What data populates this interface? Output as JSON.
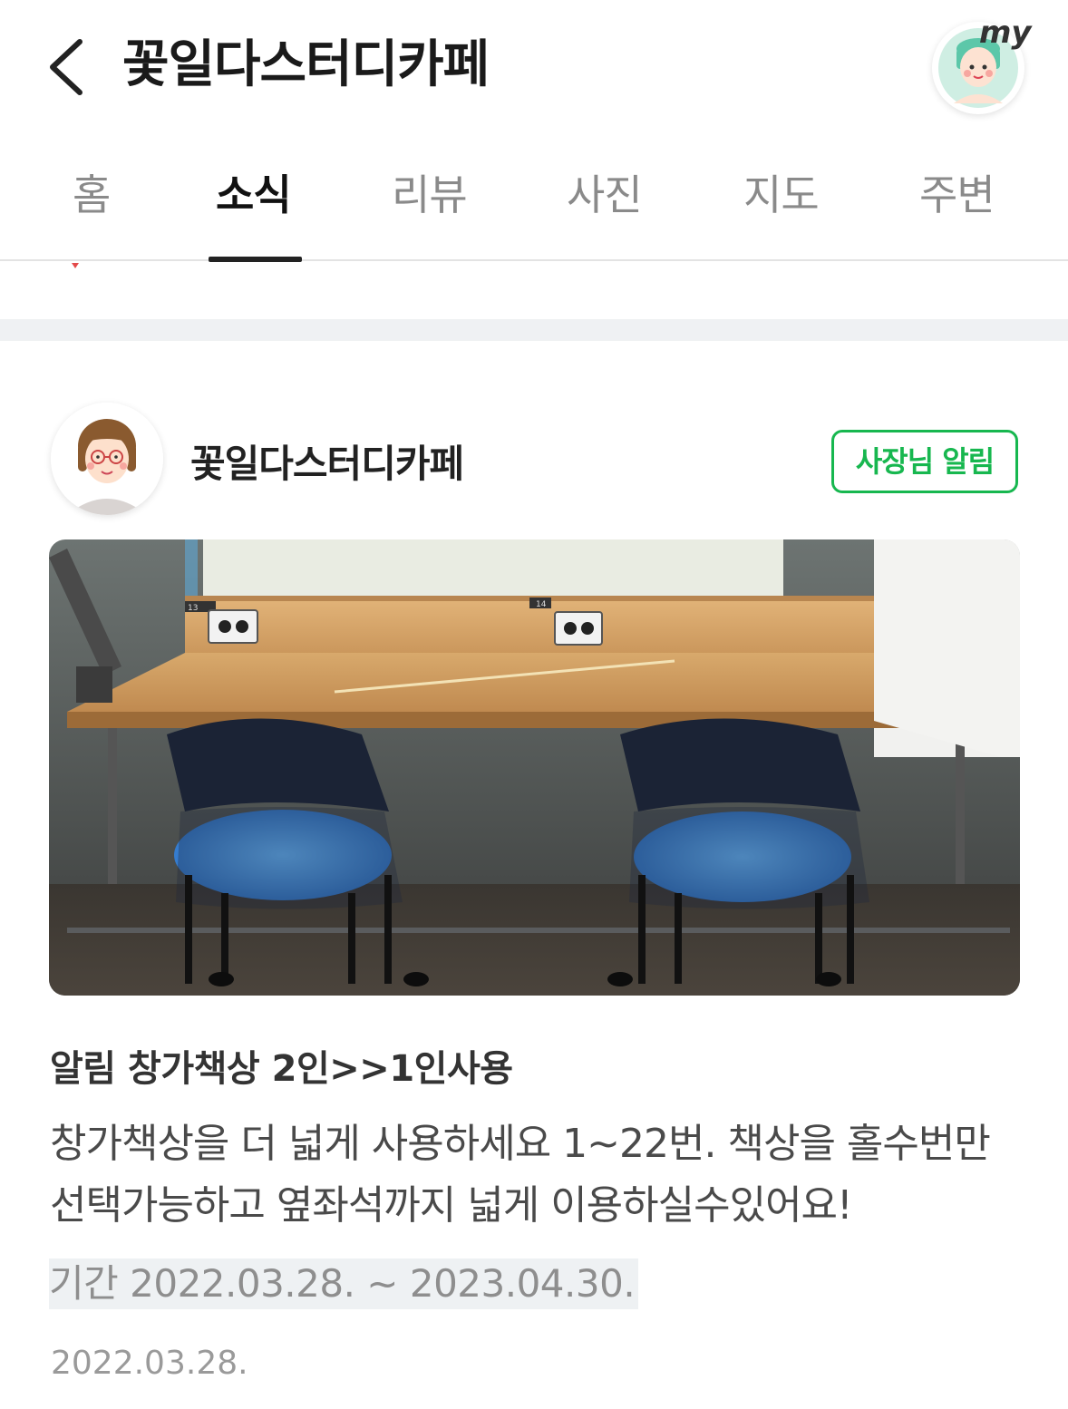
{
  "header": {
    "title": "꽃일다스터디카페",
    "my_label": "my"
  },
  "tabs": [
    {
      "label": "홈"
    },
    {
      "label": "소식"
    },
    {
      "label": "리뷰"
    },
    {
      "label": "사진"
    },
    {
      "label": "지도"
    },
    {
      "label": "주변"
    }
  ],
  "active_tab": "소식",
  "post": {
    "store_name": "꽃일다스터디카페",
    "badge": "사장님 알림",
    "title": "알림 창가책상 2인>>1인사용",
    "body": "창가책상을 더 넓게 사용하세요 1~22번. 책상을 홀수번만 선택가능하고 옆좌석까지 넓게 이용하실수있어요!",
    "period": "기간 2022.03.28. ~ 2023.04.30.",
    "date": "2022.03.28.",
    "photo_seat_labels": [
      "13",
      "14"
    ]
  },
  "colors": {
    "badge_green": "#17b74f",
    "tab_active": "#111111",
    "tab_inactive": "#8a8a8a"
  },
  "icons": {
    "back": "chevron-left-icon",
    "my": "user-avatar-icon"
  }
}
